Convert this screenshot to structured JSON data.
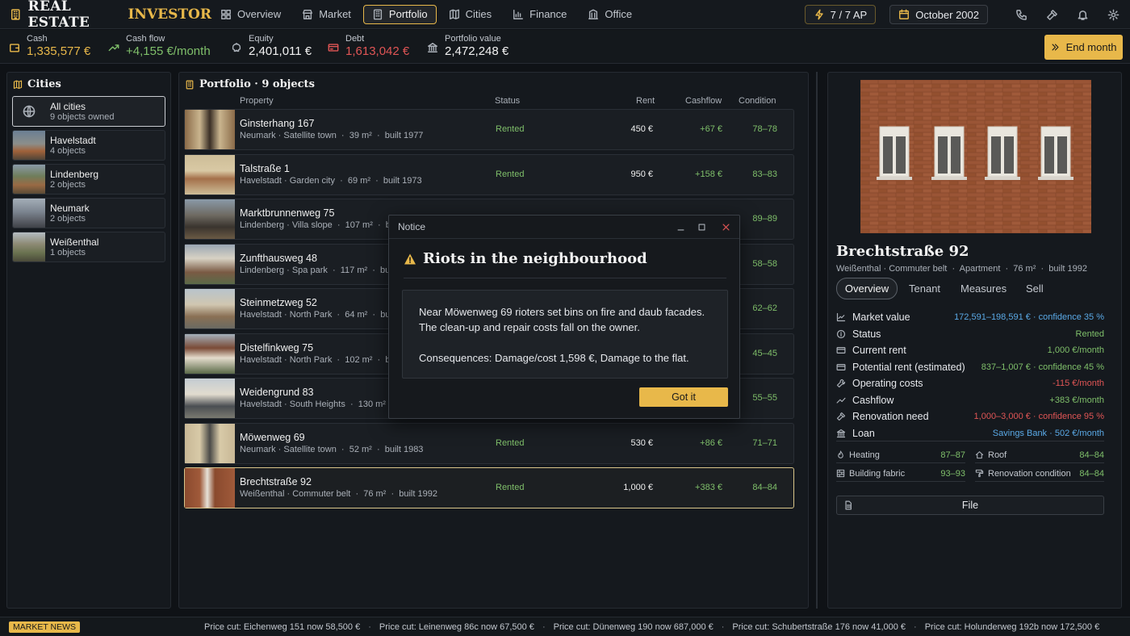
{
  "app": {
    "title_part1": "REAL ESTATE",
    "title_part2": "INVESTOR"
  },
  "nav": [
    {
      "label": "Overview",
      "icon": "grid-icon"
    },
    {
      "label": "Market",
      "icon": "store-icon"
    },
    {
      "label": "Portfolio",
      "icon": "building-icon",
      "active": true
    },
    {
      "label": "Cities",
      "icon": "map-icon"
    },
    {
      "label": "Finance",
      "icon": "chart-icon"
    },
    {
      "label": "Office",
      "icon": "office-icon"
    }
  ],
  "topright": {
    "ap": "7 / 7 AP",
    "date": "October 2002"
  },
  "stats": {
    "cash": {
      "label": "Cash",
      "value": "1,335,577 €"
    },
    "cashflow": {
      "label": "Cash flow",
      "value": "+4,155 €/month"
    },
    "equity": {
      "label": "Equity",
      "value": "2,401,011 €"
    },
    "debt": {
      "label": "Debt",
      "value": "1,613,042 €"
    },
    "portfolio": {
      "label": "Portfolio value",
      "value": "2,472,248 €"
    },
    "end_month": "End month"
  },
  "cities": {
    "title": "Cities",
    "items": [
      {
        "name": "All cities",
        "sub": "9 objects owned"
      },
      {
        "name": "Havelstadt",
        "sub": "4 objects"
      },
      {
        "name": "Lindenberg",
        "sub": "2 objects"
      },
      {
        "name": "Neumark",
        "sub": "2 objects"
      },
      {
        "name": "Weißenthal",
        "sub": "1 objects"
      }
    ]
  },
  "portfolio": {
    "title": "Portfolio · 9 objects",
    "columns": {
      "property": "Property",
      "status": "Status",
      "rent": "Rent",
      "cashflow": "Cashflow",
      "condition": "Condition"
    },
    "rows": [
      {
        "name": "Ginsterhang 167",
        "meta": "Neumark · Satellite town  ·  39 m²  ·  built 1977",
        "status": "Rented",
        "rent": "450 €",
        "cashflow": "+67 €",
        "condition": "78–78"
      },
      {
        "name": "Talstraße 1",
        "meta": "Havelstadt · Garden city  ·  69 m²  ·  built 1973",
        "status": "Rented",
        "rent": "950 €",
        "cashflow": "+158 €",
        "condition": "83–83"
      },
      {
        "name": "Marktbrunnenweg 75",
        "meta": "Lindenberg · Villa slope  ·  107 m²  ·  bu",
        "status": "",
        "rent": "",
        "cashflow": "",
        "condition": "89–89"
      },
      {
        "name": "Zunfthausweg 48",
        "meta": "Lindenberg · Spa park  ·  117 m²  ·  buil",
        "status": "",
        "rent": "",
        "cashflow": "",
        "condition": "58–58"
      },
      {
        "name": "Steinmetzweg 52",
        "meta": "Havelstadt · North Park  ·  64 m²  ·  buil",
        "status": "",
        "rent": "",
        "cashflow": "",
        "condition": "62–62"
      },
      {
        "name": "Distelfinkweg 75",
        "meta": "Havelstadt · North Park  ·  102 m²  ·  bu",
        "status": "",
        "rent": "",
        "cashflow": "",
        "condition": "45–45"
      },
      {
        "name": "Weidengrund 83",
        "meta": "Havelstadt · South Heights  ·  130 m²  ·",
        "status": "",
        "rent": "",
        "cashflow": "",
        "condition": "55–55"
      },
      {
        "name": "Möwenweg 69",
        "meta": "Neumark · Satellite town  ·  52 m²  ·  built 1983",
        "status": "Rented",
        "rent": "530 €",
        "cashflow": "+86 €",
        "condition": "71–71"
      },
      {
        "name": "Brechtstraße 92",
        "meta": "Weißenthal · Commuter belt  ·  76 m²  ·  built 1992",
        "status": "Rented",
        "rent": "1,000 €",
        "cashflow": "+383 €",
        "condition": "84–84"
      }
    ]
  },
  "dialog": {
    "bar_title": "Notice",
    "title": "Riots in the neighbourhood",
    "body": "Near Möwenweg 69 rioters set bins on fire and daub facades. The clean-up and repair costs fall on the owner.",
    "consequences": "Consequences: Damage/cost 1,598 €, Damage to the flat.",
    "button": "Got it"
  },
  "detail": {
    "name": "Brechtstraße 92",
    "meta": "Weißenthal · Commuter belt  ·  Apartment  ·  76 m²  ·  built 1992",
    "tabs": [
      "Overview",
      "Tenant",
      "Measures",
      "Sell"
    ],
    "rows": [
      {
        "label": "Market value",
        "value": "172,591–198,591 € · confidence 35 %",
        "color": "#5aa9e6",
        "icon": "line-chart-icon"
      },
      {
        "label": "Status",
        "value": "Rented",
        "color": "#7fbf6a",
        "icon": "info-icon"
      },
      {
        "label": "Current rent",
        "value": "1,000 €/month",
        "color": "#7fbf6a",
        "icon": "card-icon"
      },
      {
        "label": "Potential rent (estimated)",
        "value": "837–1,007 € · confidence 45 %",
        "color": "#7fbf6a",
        "icon": "card-icon"
      },
      {
        "label": "Operating costs",
        "value": "-115 €/month",
        "color": "#e05555",
        "icon": "wrench-icon"
      },
      {
        "label": "Cashflow",
        "value": "+383 €/month",
        "color": "#7fbf6a",
        "icon": "trend-icon"
      },
      {
        "label": "Renovation need",
        "value": "1,000–3,000 € · confidence 95 %",
        "color": "#e05555",
        "icon": "hammer-icon"
      },
      {
        "label": "Loan",
        "value": "Savings Bank · 502 €/month",
        "color": "#5aa9e6",
        "icon": "bank-icon"
      }
    ],
    "conditions": [
      {
        "label": "Heating",
        "value": "87–87"
      },
      {
        "label": "Roof",
        "value": "84–84"
      },
      {
        "label": "Building fabric",
        "value": "93–93"
      },
      {
        "label": "Renovation condition",
        "value": "84–84"
      }
    ],
    "file_button": "File"
  },
  "ticker": {
    "badge": "MARKET NEWS",
    "items": [
      "Price cut: Eichenweg 151 now 58,500 €",
      "Price cut: Leinenweg 86c now 67,500 €",
      "Price cut: Dünenweg 190 now 687,000 €",
      "Price cut: Schubertstraße 176 now 41,000 €",
      "Price cut: Holunderweg 192b now 172,500 €"
    ]
  },
  "colors": {
    "accent": "#e8b84a",
    "positive": "#7fbf6a",
    "negative": "#e05555",
    "info": "#5aa9e6"
  }
}
